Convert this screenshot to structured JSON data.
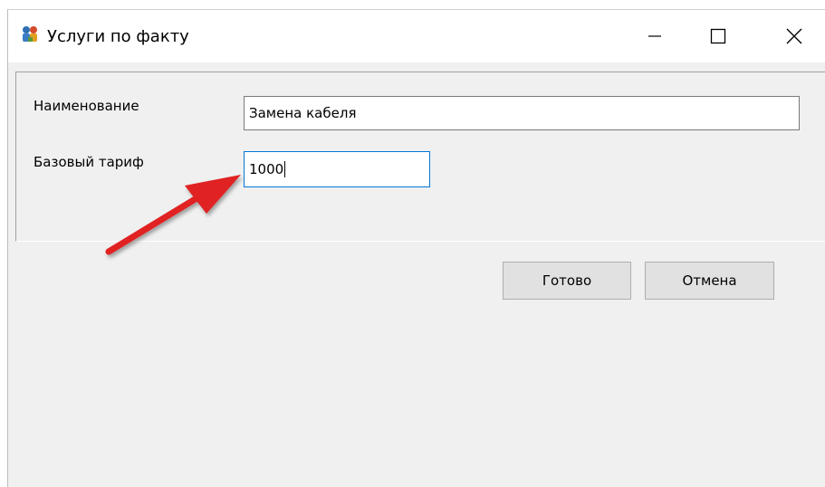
{
  "window": {
    "title": "Услуги по факту",
    "icon": "app-icon"
  },
  "form": {
    "name_label": "Наименование",
    "name_value": "Замена кабеля",
    "tariff_label": "Базовый тариф",
    "tariff_value": "1000"
  },
  "buttons": {
    "ok_label": "Готово",
    "cancel_label": "Отмена"
  },
  "annotation": {
    "arrow_color": "#e02020"
  }
}
